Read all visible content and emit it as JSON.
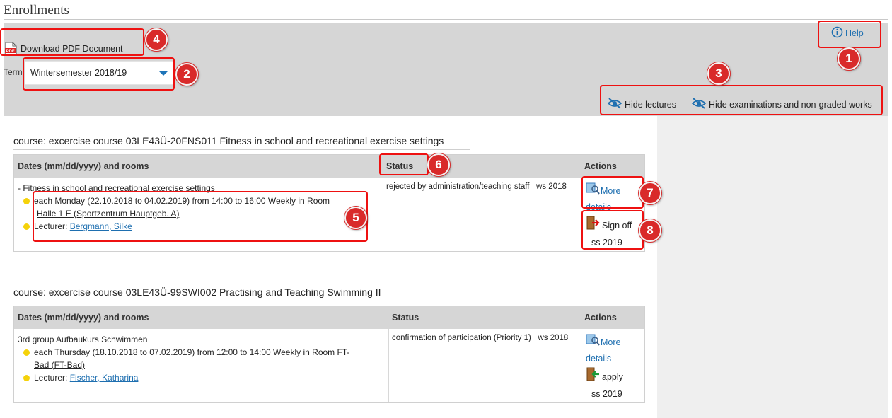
{
  "page": {
    "title": "Enrollments"
  },
  "toolbar": {
    "pdf_label": "Download PDF Document",
    "pdf_icon": "pdf-file-icon",
    "term_label": "Term",
    "term_value": "Wintersemester 2018/19",
    "help_label": "Help",
    "hide_lectures": "Hide lectures",
    "hide_exams": "Hide examinations and non-graded works"
  },
  "courses": [
    {
      "heading": "course: excercise course 03LE43Ü-20FNS011 Fitness in school and recreational exercise settings",
      "headers": {
        "dates": "Dates (mm/dd/yyyy) and rooms",
        "status": "Status",
        "actions": "Actions"
      },
      "group": "- Fitness in school and recreational exercise settings",
      "schedule": "each Monday (22.10.2018 to 04.02.2019) from 14:00 to 16:00 Weekly in Room",
      "room": "Halle 1 E (Sportzentrum Hauptgeb. A)",
      "lecturer_label": "Lecturer:",
      "lecturer": "Bergmann, Silke",
      "status": "rejected by administration/teaching staff",
      "status_term": "ws 2018",
      "action1_a": "More",
      "action1_b": "details",
      "action2": "Sign off",
      "action2_term": "ss 2019"
    },
    {
      "heading": "course: excercise course 03LE43Ü-99SWI002 Practising and Teaching Swimming II",
      "headers": {
        "dates": "Dates (mm/dd/yyyy) and rooms",
        "status": "Status",
        "actions": "Actions"
      },
      "group": "3rd group Aufbaukurs Schwimmen",
      "schedule": "each Thursday (18.10.2018 to 07.02.2019) from 12:00 to 14:00 Weekly in Room",
      "room_a": "FT-",
      "room_b": "Bad (FT-Bad)",
      "lecturer_label": "Lecturer:",
      "lecturer": "Fischer, Katharina",
      "status": "confirmation of participation (Priority 1)",
      "status_term": "ws 2018",
      "action1_a": "More",
      "action1_b": "details",
      "action2": "apply",
      "action2_term": "ss 2019"
    }
  ],
  "callouts": [
    "1",
    "2",
    "3",
    "4",
    "5",
    "6",
    "7",
    "8"
  ],
  "colors": {
    "callout": "#d92a2a",
    "link": "#1e6fb0",
    "bullet": "#f5d20a",
    "toolbar": "#d6d6d6"
  }
}
